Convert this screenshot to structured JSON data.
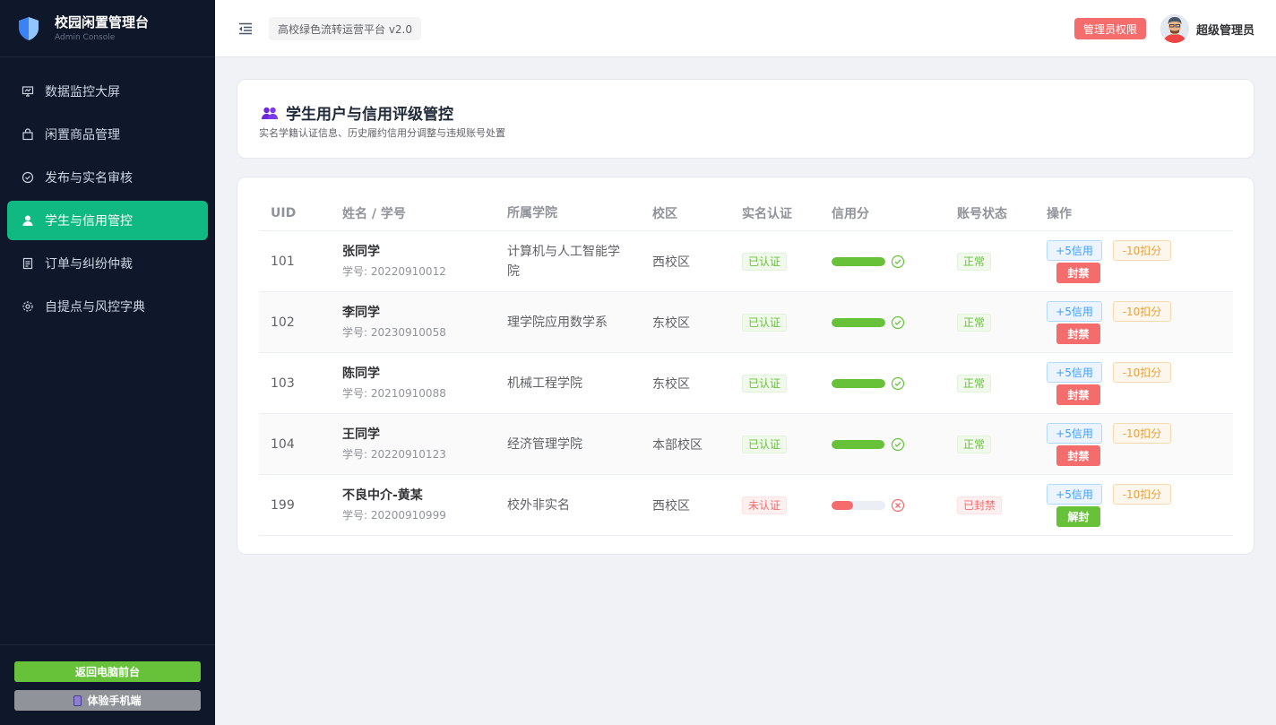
{
  "brand": {
    "title": "校园闲置管理台",
    "subtitle": "Admin Console"
  },
  "sidebar": {
    "items": [
      {
        "label": "数据监控大屏",
        "icon": "monitor-icon",
        "active": false
      },
      {
        "label": "闲置商品管理",
        "icon": "bag-icon",
        "active": false
      },
      {
        "label": "发布与实名审核",
        "icon": "check-circle-icon",
        "active": false
      },
      {
        "label": "学生与信用管控",
        "icon": "user-icon",
        "active": true
      },
      {
        "label": "订单与纠纷仲裁",
        "icon": "document-icon",
        "active": false
      },
      {
        "label": "自提点与风控字典",
        "icon": "gear-icon",
        "active": false
      }
    ],
    "back_label": "返回电脑前台",
    "mobile_label": "体验手机端"
  },
  "header": {
    "platform": "高校绿色流转运营平台 v2.0",
    "role_badge": "管理员权限",
    "user_name": "超级管理员"
  },
  "page": {
    "title": "学生用户与信用评级管控",
    "subtitle": "实名学籍认证信息、历史履约信用分调整与违规账号处置"
  },
  "table": {
    "columns": [
      "UID",
      "姓名 / 学号",
      "所属学院",
      "校区",
      "实名认证",
      "信用分",
      "账号状态",
      "操作"
    ],
    "rows": [
      {
        "uid": "101",
        "name": "张同学",
        "student_id": "学号: 20220910012",
        "college": "计算机与人工智能学院",
        "campus": "西校区",
        "verify": "已认证",
        "verified": true,
        "credit": 1.0,
        "status": "正常",
        "banned": false,
        "op_plus": "+5信用",
        "op_minus": "-10扣分",
        "op_toggle": "封禁"
      },
      {
        "uid": "102",
        "name": "李同学",
        "student_id": "学号: 20230910058",
        "college": "理学院应用数学系",
        "campus": "东校区",
        "verify": "已认证",
        "verified": true,
        "credit": 1.0,
        "status": "正常",
        "banned": false,
        "op_plus": "+5信用",
        "op_minus": "-10扣分",
        "op_toggle": "封禁"
      },
      {
        "uid": "103",
        "name": "陈同学",
        "student_id": "学号: 20210910088",
        "college": "机械工程学院",
        "campus": "东校区",
        "verify": "已认证",
        "verified": true,
        "credit": 1.0,
        "status": "正常",
        "banned": false,
        "op_plus": "+5信用",
        "op_minus": "-10扣分",
        "op_toggle": "封禁"
      },
      {
        "uid": "104",
        "name": "王同学",
        "student_id": "学号: 20220910123",
        "college": "经济管理学院",
        "campus": "本部校区",
        "verify": "已认证",
        "verified": true,
        "credit": 0.98,
        "status": "正常",
        "banned": false,
        "op_plus": "+5信用",
        "op_minus": "-10扣分",
        "op_toggle": "封禁"
      },
      {
        "uid": "199",
        "name": "不良中介-黄某",
        "student_id": "学号: 20200910999",
        "college": "校外非实名",
        "campus": "西校区",
        "verify": "未认证",
        "verified": false,
        "credit": 0.4,
        "status": "已封禁",
        "banned": true,
        "op_plus": "+5信用",
        "op_minus": "-10扣分",
        "op_toggle": "解封"
      }
    ]
  },
  "colors": {
    "sidebar_bg": "#0f172a",
    "active_menu": "#10b981",
    "success": "#67c23a",
    "danger": "#f56c6c",
    "primary": "#409eff",
    "warning": "#e6a23c"
  }
}
